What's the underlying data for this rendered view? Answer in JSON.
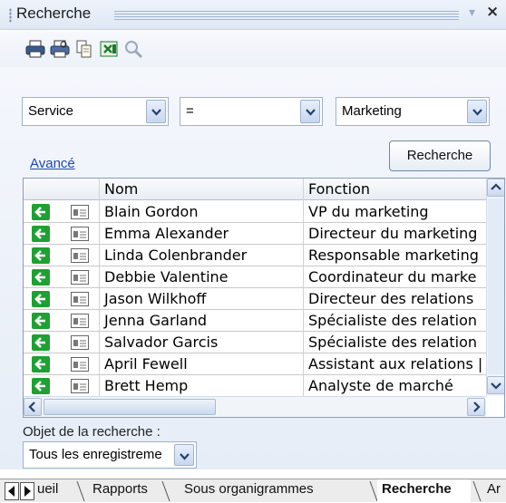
{
  "window": {
    "title": "Recherche",
    "close_label": "×",
    "pin_label": "▾"
  },
  "toolbar": {
    "icons": [
      "print-icon",
      "print-preview-icon",
      "copy-icon",
      "excel-export-icon",
      "zoom-icon"
    ]
  },
  "filter": {
    "field": "Service",
    "operator": "=",
    "value": "Marketing"
  },
  "advanced_link": "Avancé",
  "search_button": "Recherche",
  "grid": {
    "columns": [
      "Nom",
      "Fonction"
    ],
    "rows": [
      {
        "name": "Blain Gordon",
        "function": "VP du marketing"
      },
      {
        "name": "Emma Alexander",
        "function": "Directeur du marketing"
      },
      {
        "name": "Linda Colenbrander",
        "function": "Responsable marketing"
      },
      {
        "name": "Debbie Valentine",
        "function": "Coordinateur du marke"
      },
      {
        "name": "Jason Wilkhoff",
        "function": "Directeur des relations"
      },
      {
        "name": "Jenna Garland",
        "function": "Spécialiste des relation"
      },
      {
        "name": "Salvador Garcis",
        "function": "Spécialiste des relation"
      },
      {
        "name": "April Fewell",
        "function": "Assistant aux relations |"
      },
      {
        "name": "Brett Hemp",
        "function": "Analyste de marché"
      }
    ]
  },
  "search_object": {
    "label": "Objet de la recherche :",
    "value": "Tous les enregistreme"
  },
  "tabs": [
    {
      "label": "ueil",
      "active": false
    },
    {
      "label": "Rapports",
      "active": false
    },
    {
      "label": "Sous organigrammes",
      "active": false
    },
    {
      "label": "Recherche",
      "active": true
    },
    {
      "label": "Ar",
      "active": false
    }
  ],
  "colors": {
    "accent_green": "#1fa033",
    "link_blue": "#1a47b8"
  }
}
